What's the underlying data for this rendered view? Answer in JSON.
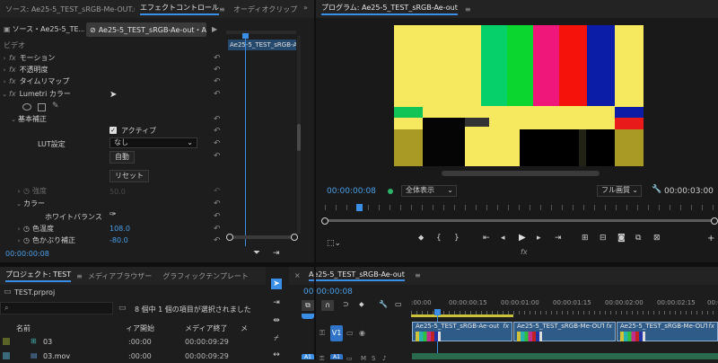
{
  "source_panel": {
    "tabs": [
      "ソース: Ae25-5_TEST_sRGB-Me-OUT.mp4",
      "エフェクトコントロール",
      "オーディオクリップ"
    ],
    "menu_icon": "hamburger-icon",
    "overflow": "»"
  },
  "effect_controls": {
    "clip_tab_source": "ソース・Ae25-5_TE...",
    "clip_tab_seq": "Ae25-5_TEST_sRGB-Ae-out・Ae2...",
    "mini_clip_label": "Ae25-5_TEST_sRGB-Ae",
    "section": "ビデオ",
    "effects": [
      "モーション",
      "不透明度",
      "タイムリマップ",
      "Lumetri カラー"
    ],
    "basic_correction": "基本補正",
    "active_label": "アクティブ",
    "lut_label": "LUT設定",
    "lut_value": "なし",
    "auto_button": "自動",
    "reset_button": "リセット",
    "intensity_label": "強度",
    "intensity_value": "50.0",
    "color_label": "カラー",
    "white_balance_label": "ホワイトバランス",
    "temperature_label": "色温度",
    "temperature_value": "108.0",
    "tint_label": "色かぶり補正",
    "tint_value": "-80.0",
    "timecode": "00:00:00:08"
  },
  "program": {
    "title": "プログラム: Ae25-5_TEST_sRGB-Ae-out",
    "timecode": "00:00:00:08",
    "fit_label": "全体表示",
    "quality_label": "フル画質",
    "duration": "00:00:03:00"
  },
  "project_panel": {
    "tabs": [
      "プロジェクト: TEST",
      "メディアブラウザー",
      "グラフィックテンプレート"
    ],
    "project_file": "TEST.prproj",
    "selection_info": "8 個中 1 個の項目が選択されました",
    "col_name": "名前",
    "col_media_start": "ィア開始",
    "col_media_end": "メディア終了",
    "col_media_dur": "メ",
    "items": [
      {
        "name": "03",
        "start": ":00:00",
        "end": "00:00:09:29"
      },
      {
        "name": "03.mov",
        "start": ":00:00",
        "end": "00:00:09:29"
      }
    ]
  },
  "timeline": {
    "sequence_name": "Ae25-5_TEST_sRGB-Ae-out",
    "timecode": "00:00:00:08",
    "ruler": [
      ":00:00",
      "00:00:00:15",
      "00:00:01:00",
      "00:00:01:15",
      "00:00:02:00",
      "00:00:02:15",
      "00:0"
    ],
    "track_v1": "V1",
    "track_a1": "A1",
    "clips": [
      {
        "label": "Ae25-5_TEST_sRGB-Ae-out...",
        "fx": "fx"
      },
      {
        "label": "Ae25-5_TEST_sRGB-Me-OUT.mp4 [V]",
        "fx": "fx"
      },
      {
        "label": "Ae25-5_TEST_sRGB-Me-OUT.mp4",
        "fx": "fx"
      }
    ]
  },
  "colors": {
    "accent": "#3a8ee6",
    "timecode_blue": "#4b9fe8",
    "panel_bg": "#1d1d1d",
    "header_bg": "#232323"
  }
}
